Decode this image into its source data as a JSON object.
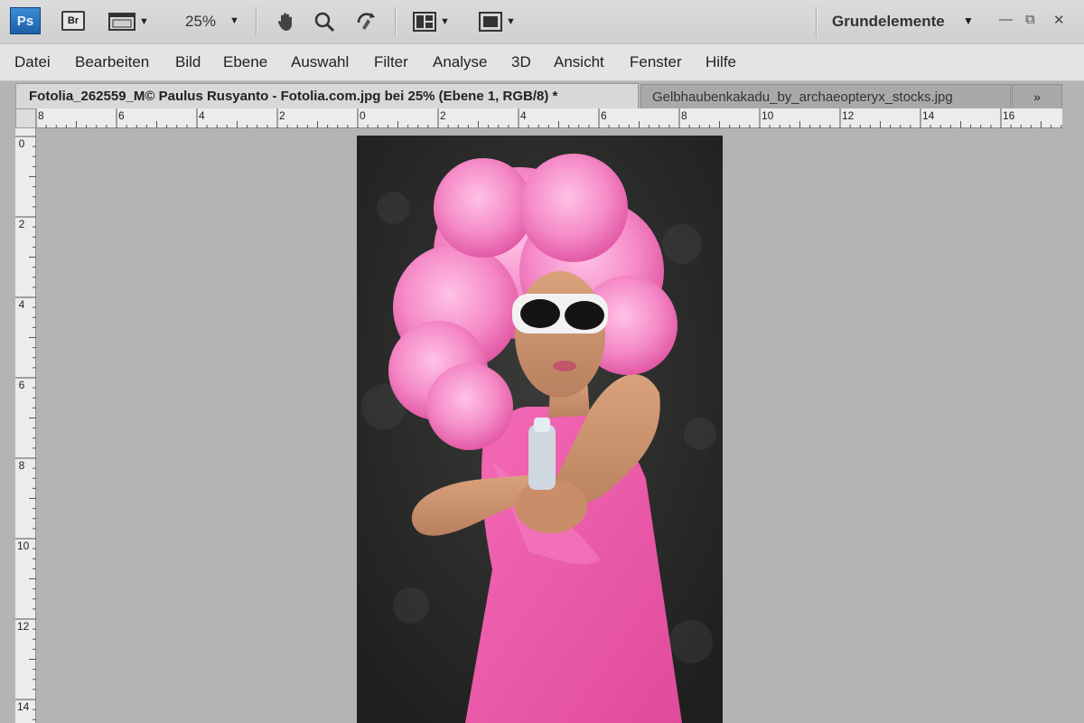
{
  "appbar": {
    "logo": "Ps",
    "bridge": "Br",
    "zoom": "25%",
    "workspace": "Grundelemente",
    "icons": [
      "screen-mode-icon",
      "hand-icon",
      "zoom-icon",
      "rotate-view-icon",
      "arrange-documents-icon",
      "screen-mode-icon"
    ]
  },
  "menu": {
    "items": [
      "Datei",
      "Bearbeiten",
      "Bild",
      "Ebene",
      "Auswahl",
      "Filter",
      "Analyse",
      "3D",
      "Ansicht",
      "Fenster",
      "Hilfe"
    ]
  },
  "tabs": {
    "active": "Fotolia_262559_M© Paulus Rusyanto - Fotolia.com.jpg bei 25% (Ebene 1, RGB/8) *",
    "inactive": "Gelbhaubenkakadu_by_archaeopteryx_stocks.jpg",
    "more": "»"
  },
  "ruler": {
    "horizontal": [
      "8",
      "6",
      "4",
      "2",
      "0",
      "2",
      "4",
      "6",
      "8",
      "10",
      "12",
      "14",
      "16"
    ],
    "vertical": [
      "0",
      "2",
      "4",
      "6",
      "8",
      "10",
      "12",
      "14"
    ]
  },
  "colors": {
    "accent_ps": "#1c5fa8",
    "canvas_bg": "#b4b4b4",
    "pink": "#f07ab8"
  }
}
